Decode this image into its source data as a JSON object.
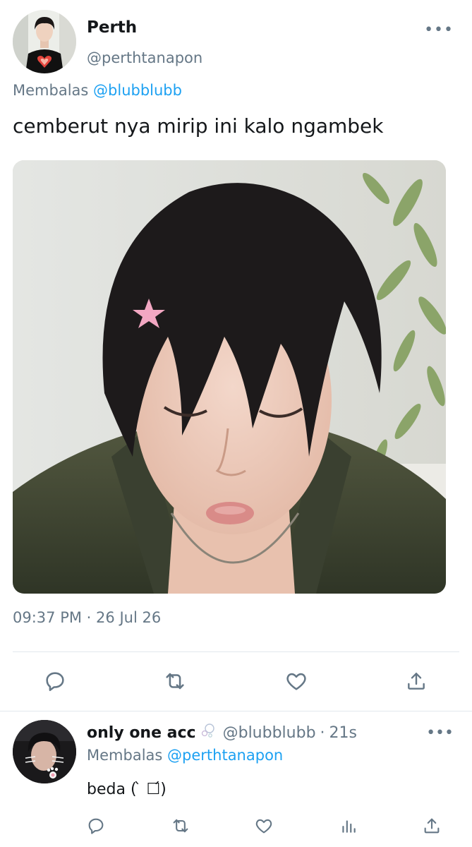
{
  "main_tweet": {
    "author_name": "Perth",
    "author_handle": "@perthtanapon",
    "replying_prefix": "Membalas",
    "replying_to": "@blubblubb",
    "text": "cemberut nya mirip ini kalo ngambek",
    "time": "09:37 PM",
    "sep": "·",
    "date": "26 Jul 26",
    "more_label": "•••",
    "actions": [
      "reply-icon",
      "retweet-icon",
      "like-icon",
      "share-icon"
    ]
  },
  "reply_tweet": {
    "author_name": "only one acc",
    "author_handle": "@blubblubb",
    "sep": "·",
    "time_ago": "21s",
    "replying_prefix": "Membalas",
    "replying_to": "@perthtanapon",
    "text": "beda ( ̀ ☐́)",
    "more_label": "•••",
    "actions": [
      "reply-icon",
      "retweet-icon",
      "like-icon",
      "analytics-icon",
      "share-icon"
    ]
  },
  "colors": {
    "text": "#14171a",
    "secondary": "#657786",
    "link": "#1da1f2",
    "divider": "#e1e8ed"
  }
}
